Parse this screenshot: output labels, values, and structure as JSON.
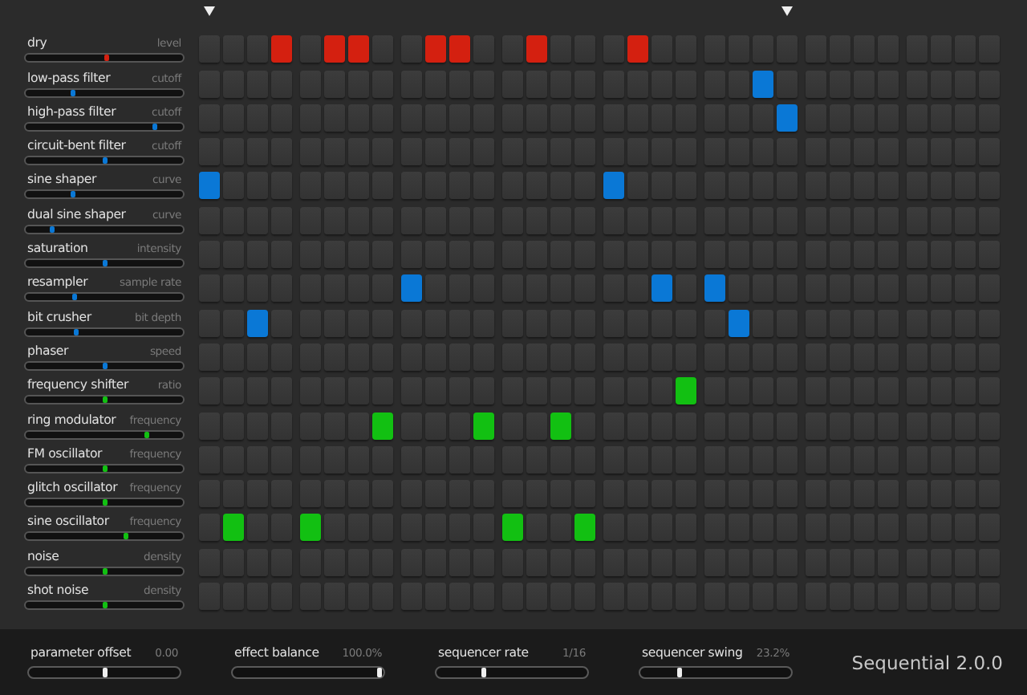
{
  "columns": [
    {
      "playhead": true
    },
    {
      "playhead": false
    },
    {
      "playhead": false
    },
    {
      "playhead": false
    },
    {
      "playhead": false
    },
    {
      "playhead": false
    },
    {
      "playhead": false
    },
    {
      "playhead": false
    },
    {
      "playhead": false
    },
    {
      "playhead": false
    },
    {
      "playhead": false
    },
    {
      "playhead": false
    },
    {
      "playhead": false
    },
    {
      "playhead": false
    },
    {
      "playhead": false
    },
    {
      "playhead": false
    },
    {
      "playhead": false
    },
    {
      "playhead": false
    },
    {
      "playhead": false
    },
    {
      "playhead": false
    },
    {
      "playhead": false
    },
    {
      "playhead": false
    },
    {
      "playhead": false
    },
    {
      "playhead": true
    },
    {
      "playhead": false
    },
    {
      "playhead": false
    },
    {
      "playhead": false
    },
    {
      "playhead": false
    },
    {
      "playhead": false
    },
    {
      "playhead": false
    },
    {
      "playhead": false
    },
    {
      "playhead": false
    }
  ],
  "rows": [
    {
      "name": "dry",
      "parameter": "level",
      "level": 0.52,
      "color": "#d42010",
      "steps": [
        false,
        false,
        false,
        true,
        false,
        true,
        true,
        false,
        false,
        true,
        true,
        false,
        false,
        true,
        false,
        false,
        false,
        true,
        false,
        false,
        false,
        false,
        false,
        false,
        false,
        false,
        false,
        false,
        false,
        false,
        false,
        false
      ]
    },
    {
      "name": "low-pass filter",
      "parameter": "cutoff",
      "level": 0.29,
      "color": "#0a78d6",
      "steps": [
        false,
        false,
        false,
        false,
        false,
        false,
        false,
        false,
        false,
        false,
        false,
        false,
        false,
        false,
        false,
        false,
        false,
        false,
        false,
        false,
        false,
        false,
        true,
        false,
        false,
        false,
        false,
        false,
        false,
        false,
        false,
        false
      ]
    },
    {
      "name": "high-pass filter",
      "parameter": "cutoff",
      "level": 0.83,
      "color": "#0a78d6",
      "steps": [
        false,
        false,
        false,
        false,
        false,
        false,
        false,
        false,
        false,
        false,
        false,
        false,
        false,
        false,
        false,
        false,
        false,
        false,
        false,
        false,
        false,
        false,
        false,
        true,
        false,
        false,
        false,
        false,
        false,
        false,
        false,
        false
      ]
    },
    {
      "name": "circuit-bent filter",
      "parameter": "cutoff",
      "level": 0.5,
      "color": "#0a78d6",
      "steps": [
        false,
        false,
        false,
        false,
        false,
        false,
        false,
        false,
        false,
        false,
        false,
        false,
        false,
        false,
        false,
        false,
        false,
        false,
        false,
        false,
        false,
        false,
        false,
        false,
        false,
        false,
        false,
        false,
        false,
        false,
        false,
        false
      ]
    },
    {
      "name": "sine shaper",
      "parameter": "curve",
      "level": 0.29,
      "color": "#0a78d6",
      "steps": [
        true,
        false,
        false,
        false,
        false,
        false,
        false,
        false,
        false,
        false,
        false,
        false,
        false,
        false,
        false,
        false,
        true,
        false,
        false,
        false,
        false,
        false,
        false,
        false,
        false,
        false,
        false,
        false,
        false,
        false,
        false,
        false
      ]
    },
    {
      "name": "dual sine shaper",
      "parameter": "curve",
      "level": 0.16,
      "color": "#0a78d6",
      "steps": [
        false,
        false,
        false,
        false,
        false,
        false,
        false,
        false,
        false,
        false,
        false,
        false,
        false,
        false,
        false,
        false,
        false,
        false,
        false,
        false,
        false,
        false,
        false,
        false,
        false,
        false,
        false,
        false,
        false,
        false,
        false,
        false
      ]
    },
    {
      "name": "saturation",
      "parameter": "intensity",
      "level": 0.5,
      "color": "#0a78d6",
      "steps": [
        false,
        false,
        false,
        false,
        false,
        false,
        false,
        false,
        false,
        false,
        false,
        false,
        false,
        false,
        false,
        false,
        false,
        false,
        false,
        false,
        false,
        false,
        false,
        false,
        false,
        false,
        false,
        false,
        false,
        false,
        false,
        false
      ]
    },
    {
      "name": "resampler",
      "parameter": "sample rate",
      "level": 0.31,
      "color": "#0a78d6",
      "steps": [
        false,
        false,
        false,
        false,
        false,
        false,
        false,
        false,
        true,
        false,
        false,
        false,
        false,
        false,
        false,
        false,
        false,
        false,
        true,
        false,
        true,
        false,
        false,
        false,
        false,
        false,
        false,
        false,
        false,
        false,
        false,
        false
      ]
    },
    {
      "name": "bit crusher",
      "parameter": "bit depth",
      "level": 0.32,
      "color": "#0a78d6",
      "steps": [
        false,
        false,
        true,
        false,
        false,
        false,
        false,
        false,
        false,
        false,
        false,
        false,
        false,
        false,
        false,
        false,
        false,
        false,
        false,
        false,
        false,
        true,
        false,
        false,
        false,
        false,
        false,
        false,
        false,
        false,
        false,
        false
      ]
    },
    {
      "name": "phaser",
      "parameter": "speed",
      "level": 0.5,
      "color": "#0a78d6",
      "steps": [
        false,
        false,
        false,
        false,
        false,
        false,
        false,
        false,
        false,
        false,
        false,
        false,
        false,
        false,
        false,
        false,
        false,
        false,
        false,
        false,
        false,
        false,
        false,
        false,
        false,
        false,
        false,
        false,
        false,
        false,
        false,
        false
      ]
    },
    {
      "name": "frequency shifter",
      "parameter": "ratio",
      "level": 0.5,
      "color": "#12c012",
      "steps": [
        false,
        false,
        false,
        false,
        false,
        false,
        false,
        false,
        false,
        false,
        false,
        false,
        false,
        false,
        false,
        false,
        false,
        false,
        false,
        true,
        false,
        false,
        false,
        false,
        false,
        false,
        false,
        false,
        false,
        false,
        false,
        false
      ]
    },
    {
      "name": "ring modulator",
      "parameter": "frequency",
      "level": 0.78,
      "color": "#12c012",
      "steps": [
        false,
        false,
        false,
        false,
        false,
        false,
        false,
        true,
        false,
        false,
        false,
        true,
        false,
        false,
        true,
        false,
        false,
        false,
        false,
        false,
        false,
        false,
        false,
        false,
        false,
        false,
        false,
        false,
        false,
        false,
        false,
        false
      ]
    },
    {
      "name": "FM oscillator",
      "parameter": "frequency",
      "level": 0.5,
      "color": "#12c012",
      "steps": [
        false,
        false,
        false,
        false,
        false,
        false,
        false,
        false,
        false,
        false,
        false,
        false,
        false,
        false,
        false,
        false,
        false,
        false,
        false,
        false,
        false,
        false,
        false,
        false,
        false,
        false,
        false,
        false,
        false,
        false,
        false,
        false
      ]
    },
    {
      "name": "glitch oscillator",
      "parameter": "frequency",
      "level": 0.5,
      "color": "#12c012",
      "steps": [
        false,
        false,
        false,
        false,
        false,
        false,
        false,
        false,
        false,
        false,
        false,
        false,
        false,
        false,
        false,
        false,
        false,
        false,
        false,
        false,
        false,
        false,
        false,
        false,
        false,
        false,
        false,
        false,
        false,
        false,
        false,
        false
      ]
    },
    {
      "name": "sine oscillator",
      "parameter": "frequency",
      "level": 0.64,
      "color": "#12c012",
      "steps": [
        false,
        true,
        false,
        false,
        true,
        false,
        false,
        false,
        false,
        false,
        false,
        false,
        true,
        false,
        false,
        true,
        false,
        false,
        false,
        false,
        false,
        false,
        false,
        false,
        false,
        false,
        false,
        false,
        false,
        false,
        false,
        false
      ]
    },
    {
      "name": "noise",
      "parameter": "density",
      "level": 0.5,
      "color": "#12c012",
      "steps": [
        false,
        false,
        false,
        false,
        false,
        false,
        false,
        false,
        false,
        false,
        false,
        false,
        false,
        false,
        false,
        false,
        false,
        false,
        false,
        false,
        false,
        false,
        false,
        false,
        false,
        false,
        false,
        false,
        false,
        false,
        false,
        false
      ]
    },
    {
      "name": "shot noise",
      "parameter": "density",
      "level": 0.5,
      "color": "#12c012",
      "steps": [
        false,
        false,
        false,
        false,
        false,
        false,
        false,
        false,
        false,
        false,
        false,
        false,
        false,
        false,
        false,
        false,
        false,
        false,
        false,
        false,
        false,
        false,
        false,
        false,
        false,
        false,
        false,
        false,
        false,
        false,
        false,
        false
      ]
    }
  ],
  "controls": [
    {
      "label": "parameter offset",
      "value": "0.00",
      "level": 0.5
    },
    {
      "label": "effect balance",
      "value": "100.0%",
      "level": 1.0
    },
    {
      "label": "sequencer rate",
      "value": "1/16",
      "level": 0.3
    },
    {
      "label": "sequencer swing",
      "value": "23.2%",
      "level": 0.25
    }
  ],
  "version": "Sequential 2.0.0"
}
